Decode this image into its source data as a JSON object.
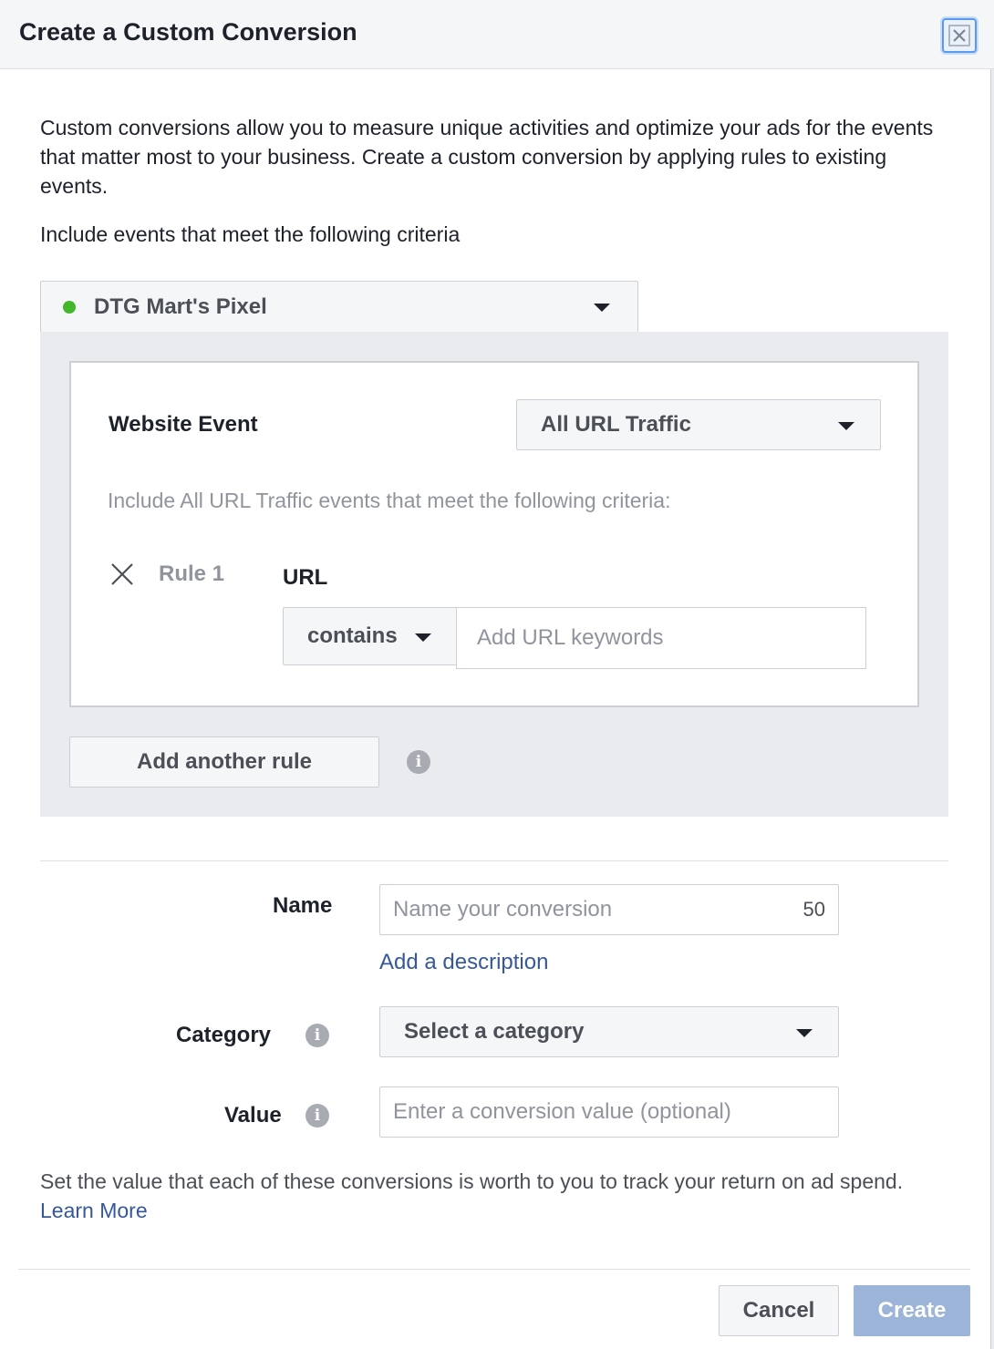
{
  "dialog": {
    "title": "Create a Custom Conversion",
    "close_icon": "close-icon"
  },
  "intro": {
    "text": "Custom conversions allow you to measure unique activities and optimize your ads for the events that matter most to your business. Create a custom conversion by applying rules to existing events.",
    "criteria_label": "Include events that meet the following criteria"
  },
  "pixel": {
    "selected": "DTG Mart's Pixel",
    "status_color": "#42b72a"
  },
  "rule_box": {
    "website_event_label": "Website Event",
    "event_selected": "All URL Traffic",
    "include_text": "Include All URL Traffic events that meet the following criteria:",
    "rule": {
      "label": "Rule 1",
      "field_label": "URL",
      "operator": "contains",
      "keywords_placeholder": "Add URL keywords"
    },
    "add_rule_label": "Add another rule"
  },
  "form": {
    "name_label": "Name",
    "name_placeholder": "Name your conversion",
    "name_char_count": "50",
    "add_description": "Add a description",
    "category_label": "Category",
    "category_selected": "Select a category",
    "value_label": "Value",
    "value_placeholder": "Enter a conversion value (optional)",
    "value_note": "Set the value that each of these conversions is worth to you to track your return on ad spend.",
    "learn_more": "Learn More"
  },
  "footer": {
    "cancel_label": "Cancel",
    "create_label": "Create"
  },
  "colors": {
    "link": "#365899",
    "create_disabled": "#9cb4d8",
    "panel_gray": "#e9ebee"
  }
}
